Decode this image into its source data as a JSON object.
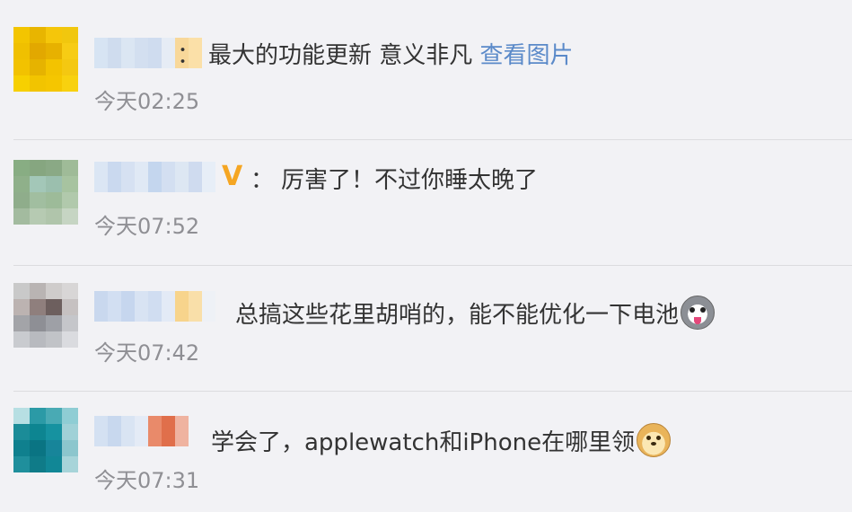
{
  "comments": [
    {
      "text": "最大的功能更新 意义非凡 ",
      "link": "查看图片",
      "time": "今天02:25",
      "avatar_colors": [
        "#f3c500",
        "#e8b500",
        "#f5c60a",
        "#f1c70e",
        "#f0c000",
        "#e2a800",
        "#e7b100",
        "#f7cc14",
        "#f2c200",
        "#e6b300",
        "#f3c300",
        "#f4c811",
        "#f7d000",
        "#f2c400",
        "#f5c600",
        "#f8d10f"
      ],
      "name_colors": [
        "#d7e4f3",
        "#cfdcee",
        "#dbe6f3",
        "#d3dff0",
        "#cfdcef",
        "#e6ecf5",
        "#f8d89a",
        "#fbe0a8"
      ],
      "has_vip": false,
      "emoji": ""
    },
    {
      "text": "厉害了！不过你睡太晚了",
      "link": "",
      "time": "今天07:52",
      "avatar_colors": [
        "#88ad83",
        "#86a680",
        "#8aa985",
        "#9fbb98",
        "#8fb08a",
        "#a3c7b8",
        "#9bbfae",
        "#a7c3a0",
        "#8fad8b",
        "#a1bea0",
        "#9dbb99",
        "#b1c9ac",
        "#a3bb9f",
        "#b6cab2",
        "#b0c5ab",
        "#c6d5c3"
      ],
      "name_colors": [
        "#dbe6f4",
        "#cad9ef",
        "#d6e1f2",
        "#e0e9f5",
        "#c4d6ee",
        "#d3dff1",
        "#dde7f3",
        "#cfdbef",
        "#e7eef7"
      ],
      "has_vip": true,
      "emoji": ""
    },
    {
      "text": "总搞这些花里胡哨的，能不能优化一下电池",
      "link": "",
      "time": "今天07:42",
      "avatar_colors": [
        "#c9c9c9",
        "#b9b4b3",
        "#cfcccb",
        "#d8d6d6",
        "#bcb3b1",
        "#8f7f7d",
        "#6d5f5e",
        "#c6c1c1",
        "#a3a4a8",
        "#8e8f95",
        "#9ea0a6",
        "#c5c6ca",
        "#c9cbcf",
        "#b8babf",
        "#c1c3c7",
        "#dadbdf"
      ],
      "name_colors": [
        "#c9d8ee",
        "#d2dff2",
        "#c6d6ee",
        "#d8e3f3",
        "#d0ddf1",
        "#e3eaf6",
        "#f7d48c",
        "#f9dfa9",
        "#eef1f6"
      ],
      "has_vip": false,
      "emoji": "husky"
    },
    {
      "text": "学会了，applewatch和iPhone在哪里领",
      "link": "",
      "time": "今天07:31",
      "avatar_colors": [
        "#b7dfe3",
        "#2b9aa6",
        "#49aab4",
        "#8fcdd4",
        "#1b8c98",
        "#0d8591",
        "#1692a0",
        "#a0d1d7",
        "#0f808e",
        "#0a7483",
        "#17859a",
        "#8cc6cd",
        "#1f8f9c",
        "#0f7b88",
        "#118796",
        "#a7d4d9"
      ],
      "name_colors": [
        "#d4e1f2",
        "#c8d8ee",
        "#d9e4f3",
        "#e4ebf6",
        "#e98a6a",
        "#e06f4b",
        "#efb3a0"
      ],
      "has_vip": false,
      "emoji": "doge"
    }
  ],
  "colon": "：",
  "vip_glyph": "V"
}
